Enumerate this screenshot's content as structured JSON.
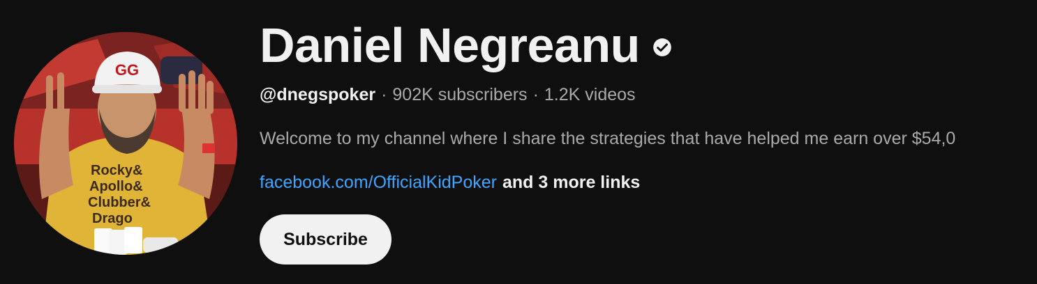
{
  "channel": {
    "name": "Daniel Negreanu",
    "verified": true,
    "handle": "@dnegspoker",
    "separator": "·",
    "subscribers": "902K subscribers",
    "videos": "1.2K videos",
    "description": "Welcome to my channel where I share the strategies that have helped me earn over $54,0",
    "link_text": "facebook.com/OfficialKidPoker",
    "more_links": "and 3 more links",
    "subscribe_label": "Subscribe"
  },
  "avatar": {
    "shirt_text": [
      "Rocky&",
      "Apollo&",
      "Clubber&",
      "Drago"
    ],
    "cap_logo": "GG"
  },
  "colors": {
    "background": "#0f0f0f",
    "primary_text": "#f1f1f1",
    "secondary_text": "#aaaaaa",
    "link": "#3ea6ff",
    "button_bg": "#f1f1f1"
  }
}
